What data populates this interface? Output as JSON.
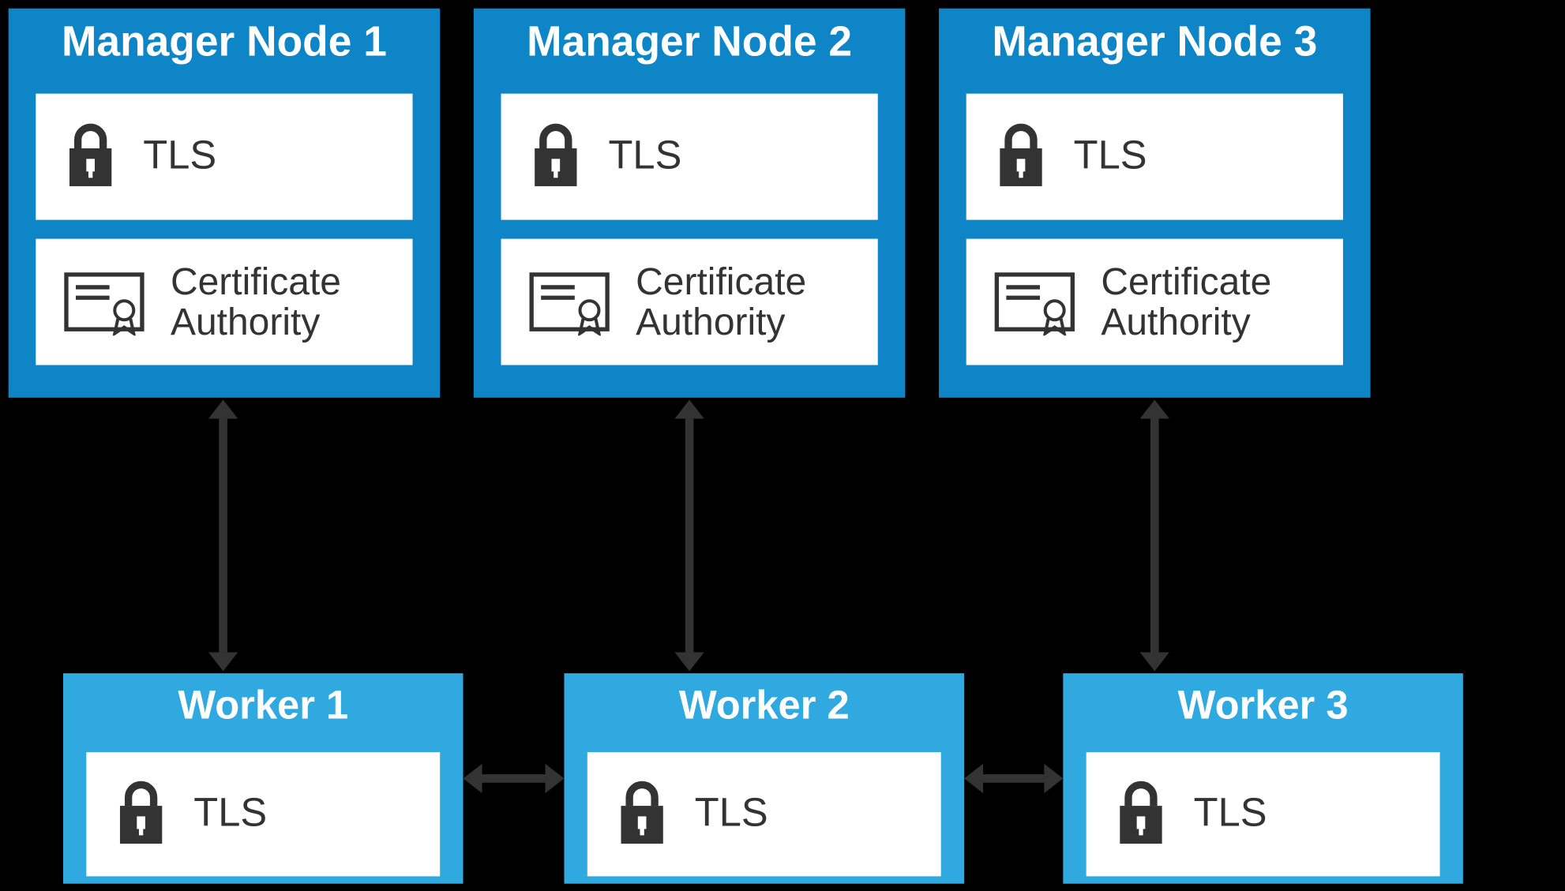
{
  "managers": [
    {
      "title": "Manager Node 1",
      "tls": "TLS",
      "ca_l1": "Certificate",
      "ca_l2": "Authority"
    },
    {
      "title": "Manager Node 2",
      "tls": "TLS",
      "ca_l1": "Certificate",
      "ca_l2": "Authority"
    },
    {
      "title": "Manager Node 3",
      "tls": "TLS",
      "ca_l1": "Certificate",
      "ca_l2": "Authority"
    }
  ],
  "workers": [
    {
      "title": "Worker 1",
      "tls": "TLS"
    },
    {
      "title": "Worker 2",
      "tls": "TLS"
    },
    {
      "title": "Worker 3",
      "tls": "TLS"
    }
  ],
  "icons": {
    "lock": "lock-icon",
    "cert": "certificate-icon"
  },
  "colors": {
    "manager_bg": "#0d85c6",
    "worker_bg": "#30a8e0",
    "arrow": "#333333",
    "text_dark": "#333333"
  }
}
